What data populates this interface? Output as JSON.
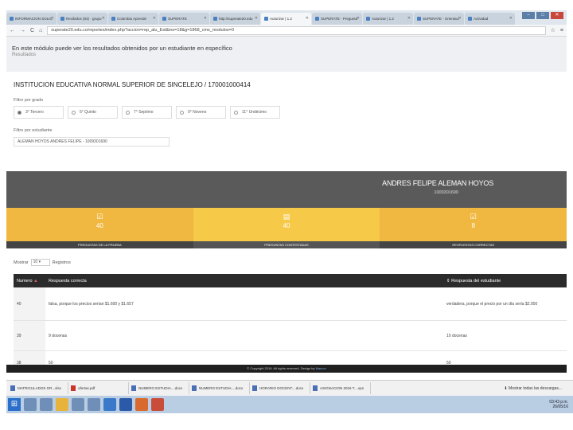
{
  "browser": {
    "tabs": [
      {
        "label": "INFORMACION SOLIC",
        "active": false
      },
      {
        "label": "Recibidos (83) - grupo",
        "active": false
      },
      {
        "label": "Colombia Aprende",
        "active": false
      },
      {
        "label": "SUPERATE",
        "active": false
      },
      {
        "label": "http://superate20.edu",
        "active": false
      },
      {
        "label": "Autorizar | 1.2",
        "active": true
      },
      {
        "label": "SUPERATE - Pregunta",
        "active": false
      },
      {
        "label": "Autorizar | 1.2",
        "active": false
      },
      {
        "label": "SUPERATE - Orientaci",
        "active": false
      },
      {
        "label": "Actividad",
        "active": false
      }
    ],
    "url": "superate20.edu.co/reportes/index.php?accion=rep_alu_Est&ins=18&g=1868_cms_modulos=0"
  },
  "page": {
    "module_title": "En este módulo puede ver los resultados obtenidos por un estudiante en específico",
    "module_subtitle": "Resultados",
    "institution": "INSTITUCION EDUCATIVA NORMAL SUPERIOR DE SINCELEJO / 170001000414",
    "grade_filter_label": "Filtro por grado",
    "grades": [
      "3° Tercero",
      "5° Quinto",
      "7° Septimo",
      "9° Noveno",
      "11° Undécimo"
    ],
    "student_filter_label": "Filtro por estudiante",
    "student_selected": "ALEMAN HOYOS ANDRES FELIPE - 1009301690",
    "student_name": "ANDRES FELIPE ALEMAN HOYOS",
    "student_id": "1009301690",
    "stats": [
      {
        "value": "40",
        "label": "PREGUNTAS DE LA PRUEBA"
      },
      {
        "value": "40",
        "label": "PREGUNTAS CONTESTADAS"
      },
      {
        "value": "8",
        "label": "RESPUESTAS CORRECTAS"
      }
    ],
    "show_label": "Mostrar",
    "show_value": "10",
    "records_label": "Registros",
    "table_headers": [
      "Numero",
      "Respuesta correcta",
      "Respuesta del estudiante"
    ],
    "rows": [
      {
        "num": "40",
        "correct": "falsa, porque los precios serían $1.600 y $1.657",
        "student": "verdadera, porque el precio por un día sería $2.000"
      },
      {
        "num": "39",
        "correct": "9 docenas",
        "student": "10 docenas"
      },
      {
        "num": "38",
        "correct": "50",
        "student": "50"
      }
    ],
    "copyright": "© Copyright 2016. All rights reserved. Design by",
    "copyright_brand": "Mamov"
  },
  "downloads": {
    "items": [
      {
        "label": "MATRICULADOS GR...xlsx",
        "type": "doc"
      },
      {
        "label": "ofertas.pdf",
        "type": "pdf"
      },
      {
        "label": "NUMERO ESTUDIA....docx",
        "type": "doc"
      },
      {
        "label": "NUMERO ESTUDIA....docx",
        "type": "doc"
      },
      {
        "label": "HORARIO DOCENT....docx",
        "type": "doc"
      },
      {
        "label": "ASIGNACION 2016 T....xps",
        "type": "doc"
      }
    ],
    "show_all": "Mostrar todas las descargas..."
  },
  "taskbar": {
    "time": "03:43 p.m.",
    "date": "26/05/16"
  }
}
